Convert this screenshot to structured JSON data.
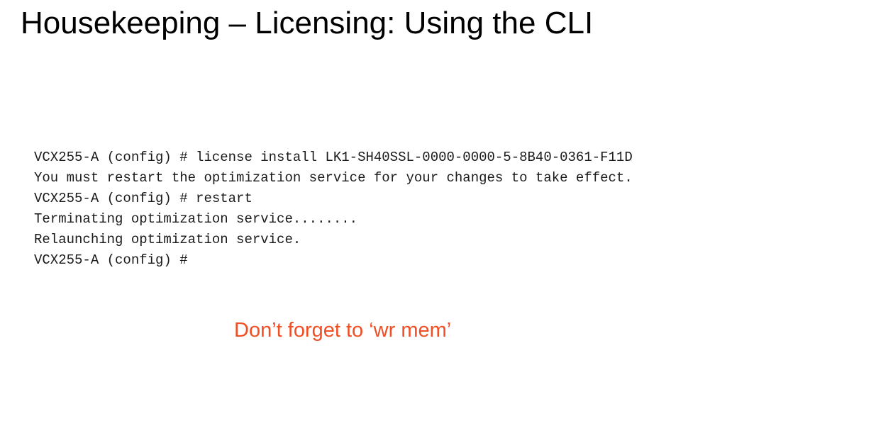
{
  "slide": {
    "title": "Housekeeping – Licensing: Using the CLI",
    "cli_lines": [
      "VCX255-A (config) # license install LK1-SH40SSL-0000-0000-5-8B40-0361-F11D",
      "You must restart the optimization service for your changes to take effect.",
      "VCX255-A (config) # restart",
      "Terminating optimization service........",
      "Relaunching optimization service.",
      "VCX255-A (config) #"
    ],
    "reminder": "Don’t forget to ‘wr mem’"
  },
  "colors": {
    "background": "#ffffff",
    "title": "#000000",
    "cli_text": "#1a1a1a",
    "reminder": "#f04e23"
  }
}
